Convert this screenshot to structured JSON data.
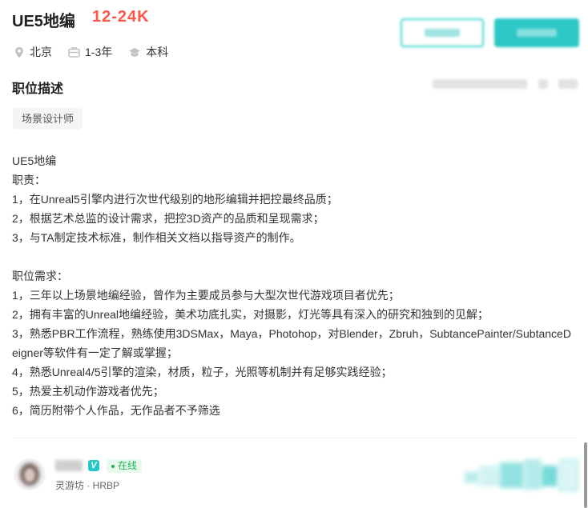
{
  "header": {
    "job_title": "UE5地编",
    "salary": "12-24K",
    "tags": [
      {
        "icon": "location-pin-icon",
        "label": "北京"
      },
      {
        "icon": "briefcase-icon",
        "label": "1-3年"
      },
      {
        "icon": "graduation-cap-icon",
        "label": "本科"
      }
    ]
  },
  "section": {
    "title": "职位描述",
    "keyword": "场景设计师"
  },
  "description": {
    "lines": [
      "UE5地编",
      "职责：",
      "1，在Unreal5引擎内进行次世代级别的地形编辑并把控最终品质；",
      "2，根据艺术总监的设计需求，把控3D资产的品质和呈现需求；",
      "3，与TA制定技术标准，制作相关文档以指导资产的制作。",
      "",
      "职位需求：",
      "1，三年以上场景地编经验，曾作为主要成员参与大型次世代游戏项目者优先；",
      "2，拥有丰富的Unreal地编经验，美术功底扎实，对摄影，灯光等具有深入的研究和独到的见解；",
      "3，熟悉PBR工作流程，熟练使用3DSMax，Maya，Photohop，对Blender，Zbruh，SubtancePainter/SubtanceDeigner等软件有一定了解或掌握；",
      "4，熟悉Unreal4/5引擎的渲染，材质，粒子，光照等机制并有足够实践经验；",
      "5，热爱主机动作游戏者优先；",
      "6，简历附带个人作品，无作品者不予筛选"
    ]
  },
  "recruiter": {
    "verified_badge": "V",
    "online_status": "在线",
    "company_role": "灵游坊 · HRBP"
  },
  "colors": {
    "salary": "#fe574a",
    "accent_teal": "#2cc7c6",
    "online_green": "#1fb356"
  }
}
